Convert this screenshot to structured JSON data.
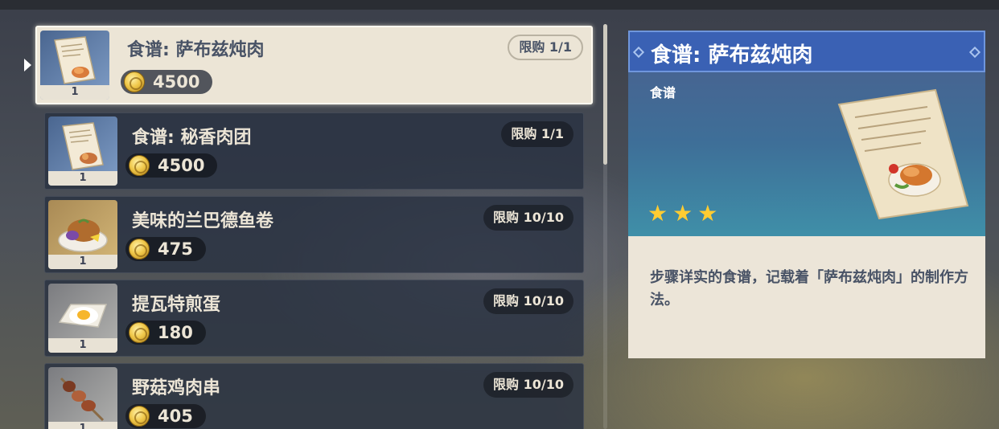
{
  "shop": {
    "items": [
      {
        "name": "食谱: 萨布兹炖肉",
        "price": "4500",
        "limit": "限购 1/1",
        "count": "1",
        "icon": "recipe-scroll"
      },
      {
        "name": "食谱: 秘香肉团",
        "price": "4500",
        "limit": "限购 1/1",
        "count": "1",
        "icon": "recipe-scroll"
      },
      {
        "name": "美味的兰巴德鱼卷",
        "price": "475",
        "limit": "限购 10/10",
        "count": "1",
        "icon": "fish-roll-dish"
      },
      {
        "name": "提瓦特煎蛋",
        "price": "180",
        "limit": "限购 10/10",
        "count": "1",
        "icon": "fried-egg-dish"
      },
      {
        "name": "野菇鸡肉串",
        "price": "405",
        "limit": "限购 10/10",
        "count": "1",
        "icon": "skewer-dish"
      }
    ],
    "currency_icon": "mora-coin",
    "selected_index": 0
  },
  "detail": {
    "title": "食谱: 萨布兹炖肉",
    "type": "食谱",
    "rarity_stars": 3,
    "stars": [
      "★",
      "★",
      "★"
    ],
    "description": "步骤详实的食谱，记载着「萨布兹炖肉」的制作方法。",
    "icon": "recipe-scroll"
  },
  "colors": {
    "title_bar": "#3a61b4",
    "star": "#ffcc32",
    "card_light": "#ece5d6",
    "card_dark": "#2a3242",
    "text_dark": "#495366"
  }
}
